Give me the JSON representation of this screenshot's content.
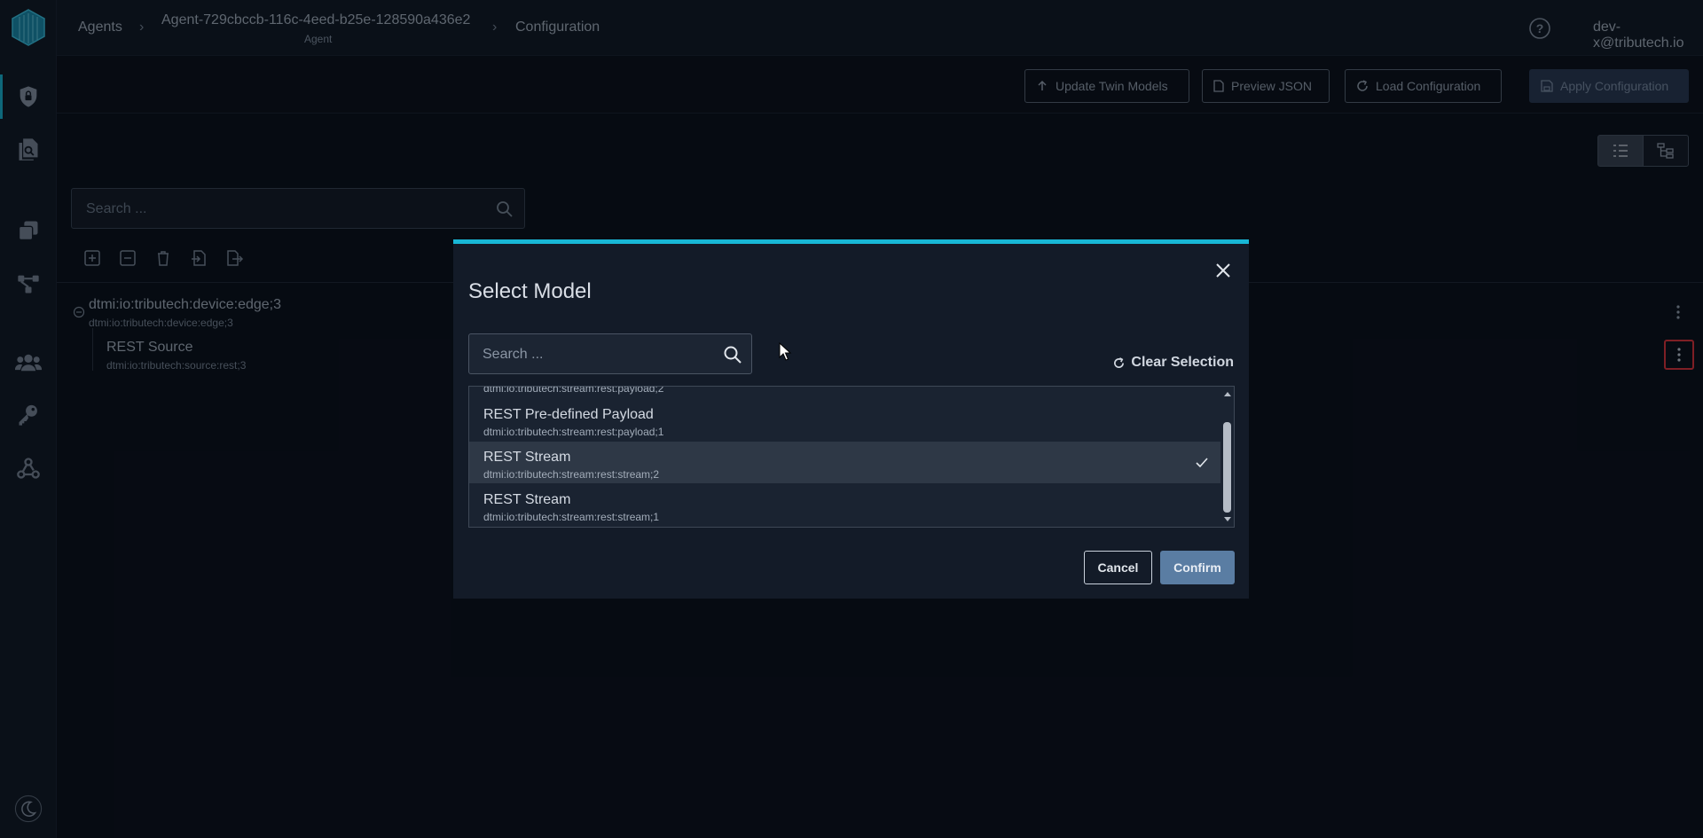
{
  "breadcrumb": {
    "agents": "Agents",
    "agent_id": "Agent-729cbccb-116c-4eed-b25e-128590a436e2",
    "agent_type": "Agent",
    "configuration": "Configuration"
  },
  "user": {
    "email": "dev-x@tributech.io"
  },
  "toolbar": {
    "update_twin_models": "Update Twin Models",
    "preview_json": "Preview JSON",
    "load_configuration": "Load Configuration",
    "apply_configuration": "Apply Configuration"
  },
  "background_search": {
    "placeholder": "Search ..."
  },
  "tree": {
    "root": {
      "title": "dtmi:io:tributech:device:edge;3",
      "subtitle": "dtmi:io:tributech:device:edge;3"
    },
    "child": {
      "title": "REST Source",
      "subtitle": "dtmi:io:tributech:source:rest;3"
    }
  },
  "modal": {
    "title": "Select Model",
    "search_placeholder": "Search ...",
    "clear_selection": "Clear Selection",
    "partial_row_subtitle": "dtmi:io:tributech:stream:rest:payload;2",
    "items": [
      {
        "title": "REST Pre-defined Payload",
        "subtitle": "dtmi:io:tributech:stream:rest:payload;1",
        "selected": false
      },
      {
        "title": "REST Stream",
        "subtitle": "dtmi:io:tributech:stream:rest:stream;2",
        "selected": true
      },
      {
        "title": "REST Stream",
        "subtitle": "dtmi:io:tributech:stream:rest:stream;1",
        "selected": false
      }
    ],
    "cancel": "Cancel",
    "confirm": "Confirm"
  },
  "colors": {
    "accent": "#18b7d6",
    "highlight_border": "#e3333b",
    "confirm_button": "#5a7da3"
  }
}
